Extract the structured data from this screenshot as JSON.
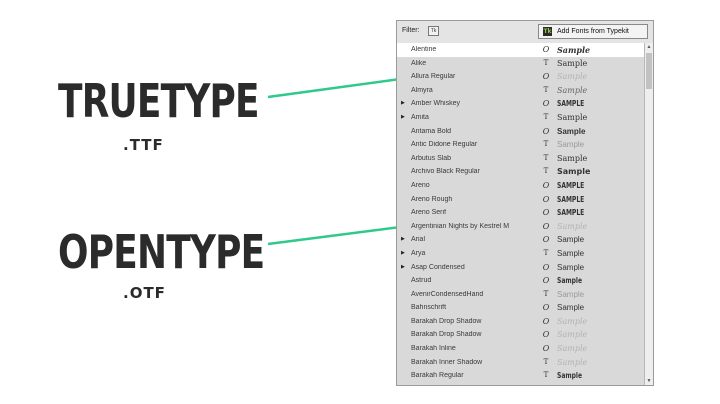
{
  "labels": {
    "truetype": "TRUETYPE",
    "truetype_ext": ".TTF",
    "opentype": "OPENTYPE",
    "opentype_ext": ".OTF"
  },
  "panel": {
    "filter_label": "Filter:",
    "filter_button": "Tk",
    "typekit_logo": "Tk",
    "typekit_button": "Add Fonts from Typekit"
  },
  "fonts": [
    {
      "name": "Alentine",
      "type": "opentype",
      "sample": "Sample",
      "style": "script",
      "expand": false,
      "selected": true
    },
    {
      "name": "Alike",
      "type": "truetype",
      "sample": "Sample",
      "style": "serif",
      "expand": false
    },
    {
      "name": "Allura Regular",
      "type": "opentype",
      "sample": "Sample",
      "style": "faint",
      "expand": false
    },
    {
      "name": "Almyra",
      "type": "truetype",
      "sample": "Sample",
      "style": "italic",
      "expand": false
    },
    {
      "name": "Amber Whiskey",
      "type": "opentype",
      "sample": "SAMPLE",
      "style": "condensed",
      "expand": true
    },
    {
      "name": "Amita",
      "type": "truetype",
      "sample": "Sample",
      "style": "serif",
      "expand": true
    },
    {
      "name": "Antama Bold",
      "type": "opentype",
      "sample": "Sample",
      "style": "bold",
      "expand": false
    },
    {
      "name": "Antic Didone Regular",
      "type": "truetype",
      "sample": "Sample",
      "style": "light",
      "expand": false
    },
    {
      "name": "Arbutus Slab",
      "type": "truetype",
      "sample": "Sample",
      "style": "serif",
      "expand": false
    },
    {
      "name": "Archivo Black Regular",
      "type": "truetype",
      "sample": "Sample",
      "style": "black",
      "expand": false
    },
    {
      "name": "Areno",
      "type": "opentype",
      "sample": "SAMPLE",
      "style": "condensed",
      "expand": false
    },
    {
      "name": "Areno Rough",
      "type": "opentype",
      "sample": "SAMPLE",
      "style": "condensed",
      "expand": false
    },
    {
      "name": "Areno Serif",
      "type": "opentype",
      "sample": "SAMPLE",
      "style": "condensed",
      "expand": false
    },
    {
      "name": "Argentinian Nights by Kestrel M",
      "type": "opentype",
      "sample": "Sample",
      "style": "faint",
      "expand": false
    },
    {
      "name": "Arial",
      "type": "opentype",
      "sample": "Sample",
      "style": "sans",
      "expand": true
    },
    {
      "name": "Arya",
      "type": "truetype",
      "sample": "Sample",
      "style": "sans",
      "expand": true
    },
    {
      "name": "Asap Condensed",
      "type": "opentype",
      "sample": "Sample",
      "style": "sans",
      "expand": true
    },
    {
      "name": "Astrud",
      "type": "opentype",
      "sample": "Sample",
      "style": "condensed",
      "expand": false
    },
    {
      "name": "AvenirCondensedHand",
      "type": "truetype",
      "sample": "Sample",
      "style": "light",
      "expand": false
    },
    {
      "name": "Bahnschrift",
      "type": "opentype",
      "sample": "Sample",
      "style": "sans",
      "expand": false
    },
    {
      "name": "Barakah Drop Shadow",
      "type": "opentype",
      "sample": "Sample",
      "style": "faint",
      "expand": false
    },
    {
      "name": "Barakah Drop Shadow",
      "type": "opentype",
      "sample": "Sample",
      "style": "faint",
      "expand": false
    },
    {
      "name": "Barakah Inline",
      "type": "opentype",
      "sample": "Sample",
      "style": "faint",
      "expand": false
    },
    {
      "name": "Barakah Inner Shadow",
      "type": "truetype",
      "sample": "Sample",
      "style": "faint",
      "expand": false
    },
    {
      "name": "Barakah Regular",
      "type": "truetype",
      "sample": "Sample",
      "style": "condensed",
      "expand": false
    }
  ],
  "colors": {
    "arrow": "#2fc98a",
    "label_text": "#2b2b2b",
    "panel_bg": "#d9d9d9",
    "selected_row": "#ffffff"
  },
  "icons": {
    "opentype": "O",
    "truetype": "T"
  }
}
